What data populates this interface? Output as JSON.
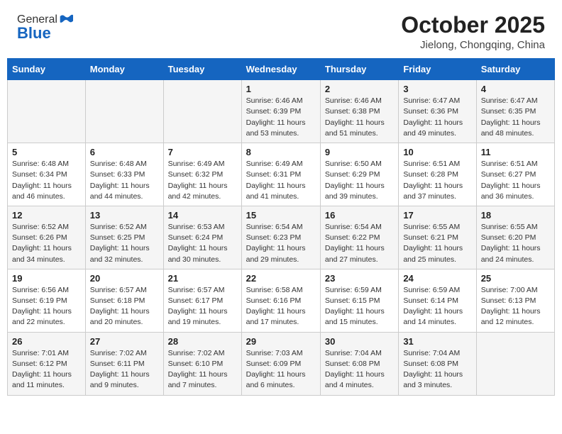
{
  "logo": {
    "general": "General",
    "blue": "Blue"
  },
  "header": {
    "month": "October 2025",
    "location": "Jielong, Chongqing, China"
  },
  "days_of_week": [
    "Sunday",
    "Monday",
    "Tuesday",
    "Wednesday",
    "Thursday",
    "Friday",
    "Saturday"
  ],
  "weeks": [
    [
      {
        "day": "",
        "info": ""
      },
      {
        "day": "",
        "info": ""
      },
      {
        "day": "",
        "info": ""
      },
      {
        "day": "1",
        "info": "Sunrise: 6:46 AM\nSunset: 6:39 PM\nDaylight: 11 hours and 53 minutes."
      },
      {
        "day": "2",
        "info": "Sunrise: 6:46 AM\nSunset: 6:38 PM\nDaylight: 11 hours and 51 minutes."
      },
      {
        "day": "3",
        "info": "Sunrise: 6:47 AM\nSunset: 6:36 PM\nDaylight: 11 hours and 49 minutes."
      },
      {
        "day": "4",
        "info": "Sunrise: 6:47 AM\nSunset: 6:35 PM\nDaylight: 11 hours and 48 minutes."
      }
    ],
    [
      {
        "day": "5",
        "info": "Sunrise: 6:48 AM\nSunset: 6:34 PM\nDaylight: 11 hours and 46 minutes."
      },
      {
        "day": "6",
        "info": "Sunrise: 6:48 AM\nSunset: 6:33 PM\nDaylight: 11 hours and 44 minutes."
      },
      {
        "day": "7",
        "info": "Sunrise: 6:49 AM\nSunset: 6:32 PM\nDaylight: 11 hours and 42 minutes."
      },
      {
        "day": "8",
        "info": "Sunrise: 6:49 AM\nSunset: 6:31 PM\nDaylight: 11 hours and 41 minutes."
      },
      {
        "day": "9",
        "info": "Sunrise: 6:50 AM\nSunset: 6:29 PM\nDaylight: 11 hours and 39 minutes."
      },
      {
        "day": "10",
        "info": "Sunrise: 6:51 AM\nSunset: 6:28 PM\nDaylight: 11 hours and 37 minutes."
      },
      {
        "day": "11",
        "info": "Sunrise: 6:51 AM\nSunset: 6:27 PM\nDaylight: 11 hours and 36 minutes."
      }
    ],
    [
      {
        "day": "12",
        "info": "Sunrise: 6:52 AM\nSunset: 6:26 PM\nDaylight: 11 hours and 34 minutes."
      },
      {
        "day": "13",
        "info": "Sunrise: 6:52 AM\nSunset: 6:25 PM\nDaylight: 11 hours and 32 minutes."
      },
      {
        "day": "14",
        "info": "Sunrise: 6:53 AM\nSunset: 6:24 PM\nDaylight: 11 hours and 30 minutes."
      },
      {
        "day": "15",
        "info": "Sunrise: 6:54 AM\nSunset: 6:23 PM\nDaylight: 11 hours and 29 minutes."
      },
      {
        "day": "16",
        "info": "Sunrise: 6:54 AM\nSunset: 6:22 PM\nDaylight: 11 hours and 27 minutes."
      },
      {
        "day": "17",
        "info": "Sunrise: 6:55 AM\nSunset: 6:21 PM\nDaylight: 11 hours and 25 minutes."
      },
      {
        "day": "18",
        "info": "Sunrise: 6:55 AM\nSunset: 6:20 PM\nDaylight: 11 hours and 24 minutes."
      }
    ],
    [
      {
        "day": "19",
        "info": "Sunrise: 6:56 AM\nSunset: 6:19 PM\nDaylight: 11 hours and 22 minutes."
      },
      {
        "day": "20",
        "info": "Sunrise: 6:57 AM\nSunset: 6:18 PM\nDaylight: 11 hours and 20 minutes."
      },
      {
        "day": "21",
        "info": "Sunrise: 6:57 AM\nSunset: 6:17 PM\nDaylight: 11 hours and 19 minutes."
      },
      {
        "day": "22",
        "info": "Sunrise: 6:58 AM\nSunset: 6:16 PM\nDaylight: 11 hours and 17 minutes."
      },
      {
        "day": "23",
        "info": "Sunrise: 6:59 AM\nSunset: 6:15 PM\nDaylight: 11 hours and 15 minutes."
      },
      {
        "day": "24",
        "info": "Sunrise: 6:59 AM\nSunset: 6:14 PM\nDaylight: 11 hours and 14 minutes."
      },
      {
        "day": "25",
        "info": "Sunrise: 7:00 AM\nSunset: 6:13 PM\nDaylight: 11 hours and 12 minutes."
      }
    ],
    [
      {
        "day": "26",
        "info": "Sunrise: 7:01 AM\nSunset: 6:12 PM\nDaylight: 11 hours and 11 minutes."
      },
      {
        "day": "27",
        "info": "Sunrise: 7:02 AM\nSunset: 6:11 PM\nDaylight: 11 hours and 9 minutes."
      },
      {
        "day": "28",
        "info": "Sunrise: 7:02 AM\nSunset: 6:10 PM\nDaylight: 11 hours and 7 minutes."
      },
      {
        "day": "29",
        "info": "Sunrise: 7:03 AM\nSunset: 6:09 PM\nDaylight: 11 hours and 6 minutes."
      },
      {
        "day": "30",
        "info": "Sunrise: 7:04 AM\nSunset: 6:08 PM\nDaylight: 11 hours and 4 minutes."
      },
      {
        "day": "31",
        "info": "Sunrise: 7:04 AM\nSunset: 6:08 PM\nDaylight: 11 hours and 3 minutes."
      },
      {
        "day": "",
        "info": ""
      }
    ]
  ]
}
